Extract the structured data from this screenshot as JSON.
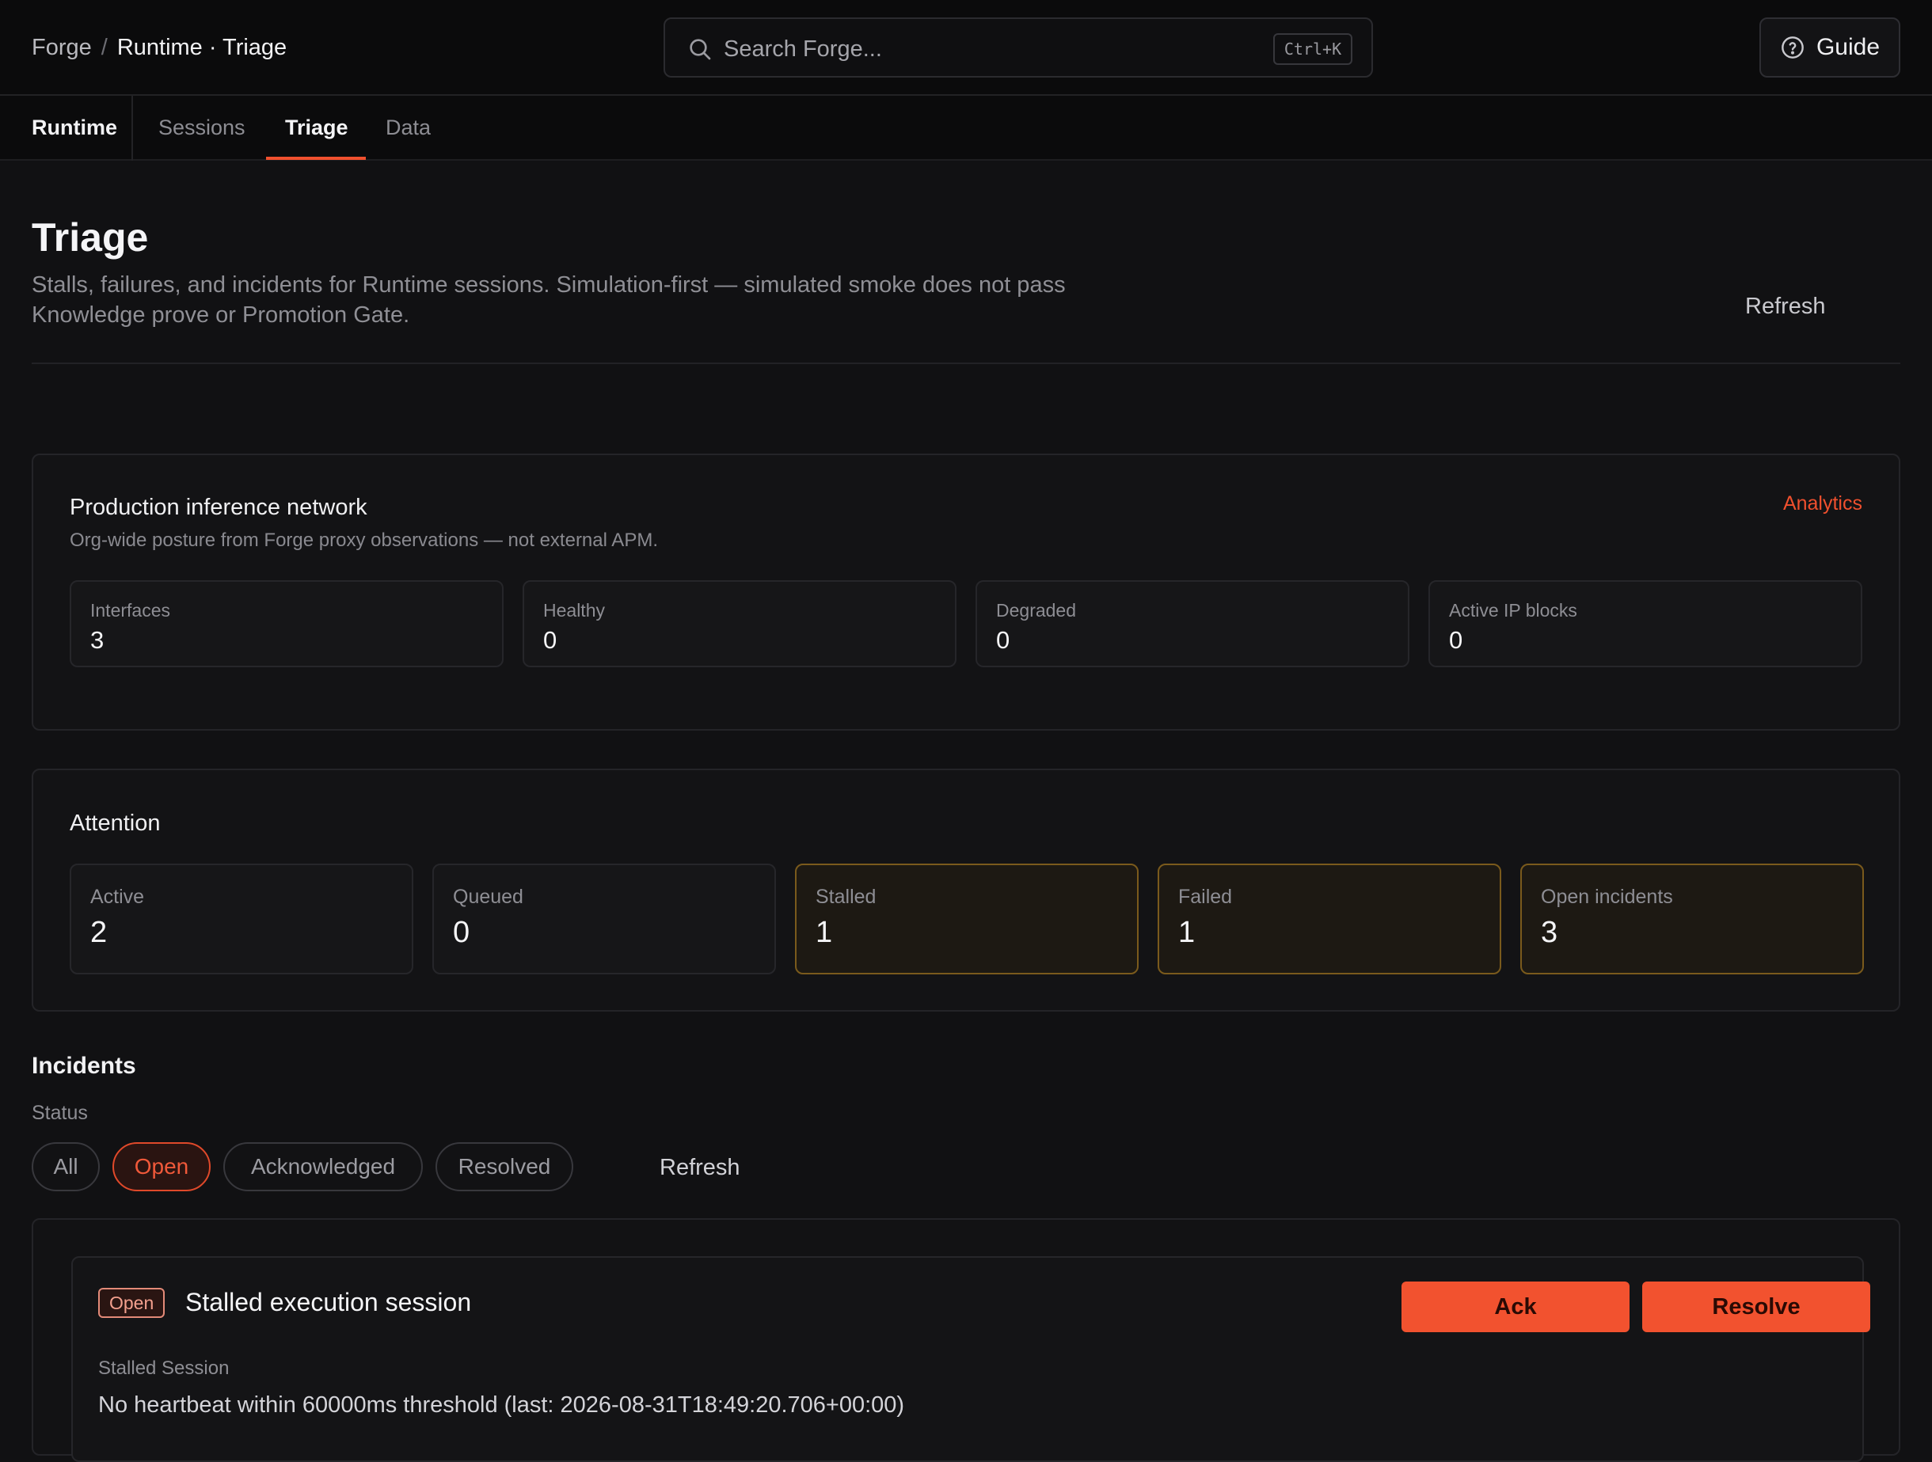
{
  "breadcrumb": {
    "root": "Forge",
    "separator": "/",
    "current": "Runtime · Triage"
  },
  "search": {
    "placeholder": "Search Forge...",
    "shortcut": "Ctrl+K"
  },
  "guide": {
    "label": "Guide"
  },
  "nav": {
    "section": "Runtime",
    "tabs": [
      {
        "label": "Sessions",
        "active": false
      },
      {
        "label": "Triage",
        "active": true
      },
      {
        "label": "Data",
        "active": false
      }
    ]
  },
  "page": {
    "title": "Triage",
    "description": "Stalls, failures, and incidents for Runtime sessions. Simulation-first — simulated smoke does not pass Knowledge prove or Promotion Gate.",
    "refresh_label": "Refresh"
  },
  "network": {
    "title": "Production inference network",
    "subtitle": "Org-wide posture from Forge proxy observations — not external APM.",
    "analytics_label": "Analytics",
    "stats": [
      {
        "label": "Interfaces",
        "value": "3"
      },
      {
        "label": "Healthy",
        "value": "0"
      },
      {
        "label": "Degraded",
        "value": "0"
      },
      {
        "label": "Active IP blocks",
        "value": "0"
      }
    ]
  },
  "attention": {
    "title": "Attention",
    "stats": [
      {
        "label": "Active",
        "value": "2",
        "highlight": false
      },
      {
        "label": "Queued",
        "value": "0",
        "highlight": false
      },
      {
        "label": "Stalled",
        "value": "1",
        "highlight": true
      },
      {
        "label": "Failed",
        "value": "1",
        "highlight": true
      },
      {
        "label": "Open incidents",
        "value": "3",
        "highlight": true
      }
    ]
  },
  "incidents": {
    "title": "Incidents",
    "status_label": "Status",
    "filters": [
      {
        "label": "All",
        "active": false
      },
      {
        "label": "Open",
        "active": true
      },
      {
        "label": "Acknowledged",
        "active": false
      },
      {
        "label": "Resolved",
        "active": false
      }
    ],
    "refresh_label": "Refresh",
    "items": [
      {
        "badge": "Open",
        "title": "Stalled execution session",
        "ack_label": "Ack",
        "resolve_label": "Resolve",
        "type": "Stalled Session",
        "detail": "No heartbeat within 60000ms threshold (last: 2026-08-31T18:49:20.706+00:00)"
      }
    ]
  },
  "colors": {
    "accent": "#f0502e",
    "warning_border": "#7a5a1c",
    "background": "#111113"
  }
}
